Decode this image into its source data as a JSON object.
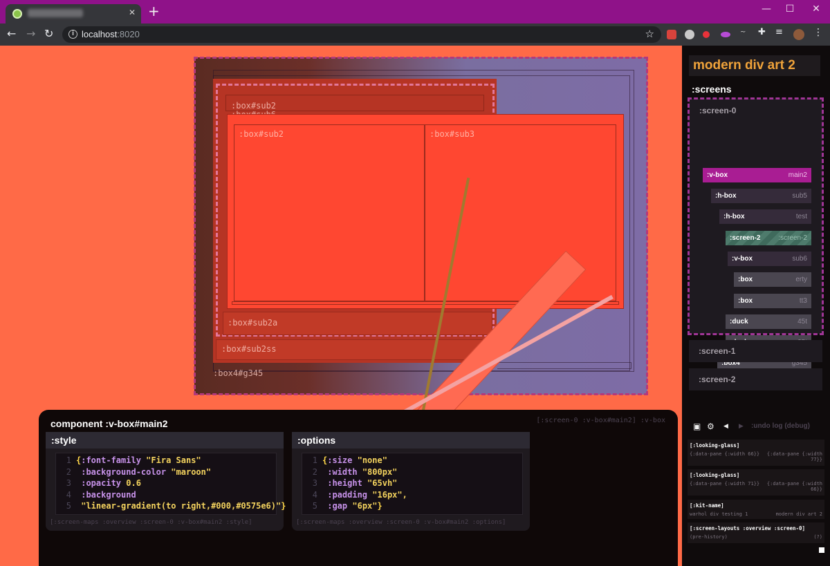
{
  "browser": {
    "new_tab": "+",
    "url_host": "localhost",
    "url_port": ":8020",
    "window": {
      "minimize": "—",
      "maximize": "☐",
      "close": "✕"
    },
    "icons": {
      "back": "arrow-left-icon",
      "forward": "arrow-right-icon",
      "reload": "reload-icon",
      "bookmark": "star-icon"
    }
  },
  "canvas": {
    "labels": {
      "sub2_top": ":box#sub2",
      "sub6": ":box#sub6",
      "sub2": ":box#sub2",
      "sub3": ":box#sub3",
      "sub2a": ":box#sub2a",
      "sub2ss": ":box#sub2ss",
      "g345": ":box4#g345"
    },
    "colors": {
      "canvas_bg": "#ff6a47",
      "main_outline": "#b4397b",
      "test_outline": "#e2779a"
    }
  },
  "component": {
    "title": "component :v-box#main2",
    "crumb": "[:screen-0 :v-box#main2] :v-box",
    "style": {
      "header": ":style",
      "lines": [
        {
          "n": "1",
          "open": "{",
          "key": ":font-family",
          "val": "\"Fira Sans\"",
          "close": ""
        },
        {
          "n": "2",
          "open": "",
          "key": ":background-color",
          "val": "\"maroon\"",
          "close": ""
        },
        {
          "n": "3",
          "open": "",
          "key": ":opacity",
          "val": "0.6",
          "close": ""
        },
        {
          "n": "4",
          "open": "",
          "key": ":background",
          "val": "",
          "close": ""
        },
        {
          "n": "5",
          "open": "",
          "key": "",
          "val": "\"linear-gradient(to right,#000,#0575e6)\"",
          "close": "}"
        }
      ],
      "path": "[:screen-maps :overview :screen-0 :v-box#main2 :style]"
    },
    "options": {
      "header": ":options",
      "lines": [
        {
          "n": "1",
          "open": "{",
          "key": ":size",
          "val": "\"none\"",
          "close": ""
        },
        {
          "n": "2",
          "open": "",
          "key": ":width",
          "val": "\"800px\"",
          "close": ""
        },
        {
          "n": "3",
          "open": "",
          "key": ":height",
          "val": "\"65vh\"",
          "close": ""
        },
        {
          "n": "4",
          "open": "",
          "key": ":padding",
          "val": "\"16px\",",
          "close": ""
        },
        {
          "n": "5",
          "open": "",
          "key": ":gap",
          "val": "\"6px\"",
          "close": "}"
        }
      ],
      "path": "[:screen-maps :overview :screen-0 :v-box#main2 :options]"
    }
  },
  "sidebar": {
    "title": "modern div art 2",
    "screens_heading": ":screens",
    "screen0": {
      "label": ":screen-0",
      "nodes": [
        {
          "k": ":v-box",
          "v": "main2"
        },
        {
          "k": ":h-box",
          "v": "sub5"
        },
        {
          "k": ":h-box",
          "v": "test"
        },
        {
          "k": ":screen-2",
          "v": ":screen-2"
        },
        {
          "k": ":v-box",
          "v": "sub6"
        },
        {
          "k": ":box",
          "v": "erty"
        },
        {
          "k": ":box",
          "v": "tt3"
        },
        {
          "k": ":duck",
          "v": "45t"
        },
        {
          "k": ":duck",
          "v": "25t"
        },
        {
          "k": ":box4",
          "v": "g345"
        }
      ]
    },
    "screen1": ":screen-1",
    "screen2": ":screen-2",
    "undo": {
      "label": ":undo log (debug)",
      "icons": {
        "save": "save-icon",
        "settings": "gear-icon",
        "prev": "chevron-left-icon",
        "next": "chevron-right-icon"
      }
    },
    "log": [
      {
        "title": "[:looking-glass]",
        "left": "{:data-pane {:width 66}}",
        "right": "{:data-pane {:width\n77}}"
      },
      {
        "title": "[:looking-glass]",
        "left": "{:data-pane {:width 71}}",
        "right": "{:data-pane {:width\n66}}"
      },
      {
        "title": "[:kit-name]",
        "left": "warhol div testing 1",
        "right": "modern div art 2"
      },
      {
        "title": "[:screen-layouts :overview :screen-0]",
        "left": "(pre-history)",
        "right": "(?)"
      }
    ]
  }
}
